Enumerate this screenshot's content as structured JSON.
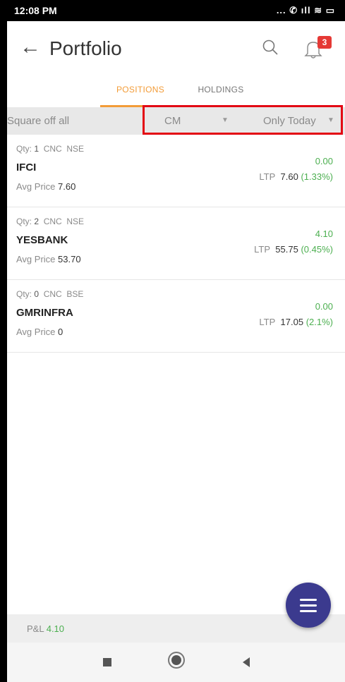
{
  "status_bar": {
    "time": "12:08 PM",
    "icons": "... ✆ ıll ≋ ▭"
  },
  "header": {
    "back_icon": "arrow-left-icon",
    "title": "Portfolio",
    "notification_count": "3"
  },
  "tabs": [
    {
      "label": "POSITIONS",
      "active": true
    },
    {
      "label": "HOLDINGS",
      "active": false
    }
  ],
  "filter": {
    "square_off_label": "Square off all",
    "segment": "CM",
    "period": "Only Today"
  },
  "positions": [
    {
      "qty_label": "Qty:",
      "qty": "1",
      "product": "CNC",
      "exchange": "NSE",
      "symbol": "IFCI",
      "avg_label": "Avg Price",
      "avg_price": "7.60",
      "pnl": "0.00",
      "ltp_label": "LTP",
      "ltp": "7.60",
      "change": "(1.33%)"
    },
    {
      "qty_label": "Qty:",
      "qty": "2",
      "product": "CNC",
      "exchange": "NSE",
      "symbol": "YESBANK",
      "avg_label": "Avg Price",
      "avg_price": "53.70",
      "pnl": "4.10",
      "ltp_label": "LTP",
      "ltp": "55.75",
      "change": "(0.45%)"
    },
    {
      "qty_label": "Qty:",
      "qty": "0",
      "product": "CNC",
      "exchange": "BSE",
      "symbol": "GMRINFRA",
      "avg_label": "Avg Price",
      "avg_price": "0",
      "pnl": "0.00",
      "ltp_label": "LTP",
      "ltp": "17.05",
      "change": "(2.1%)"
    }
  ],
  "footer": {
    "pl_label": "P&L",
    "pl_value": "4.10"
  },
  "colors": {
    "accent": "#f39c38",
    "positive": "#4caf50",
    "fab": "#3b3a8e",
    "badge": "#e53935",
    "highlight": "#e30613"
  }
}
